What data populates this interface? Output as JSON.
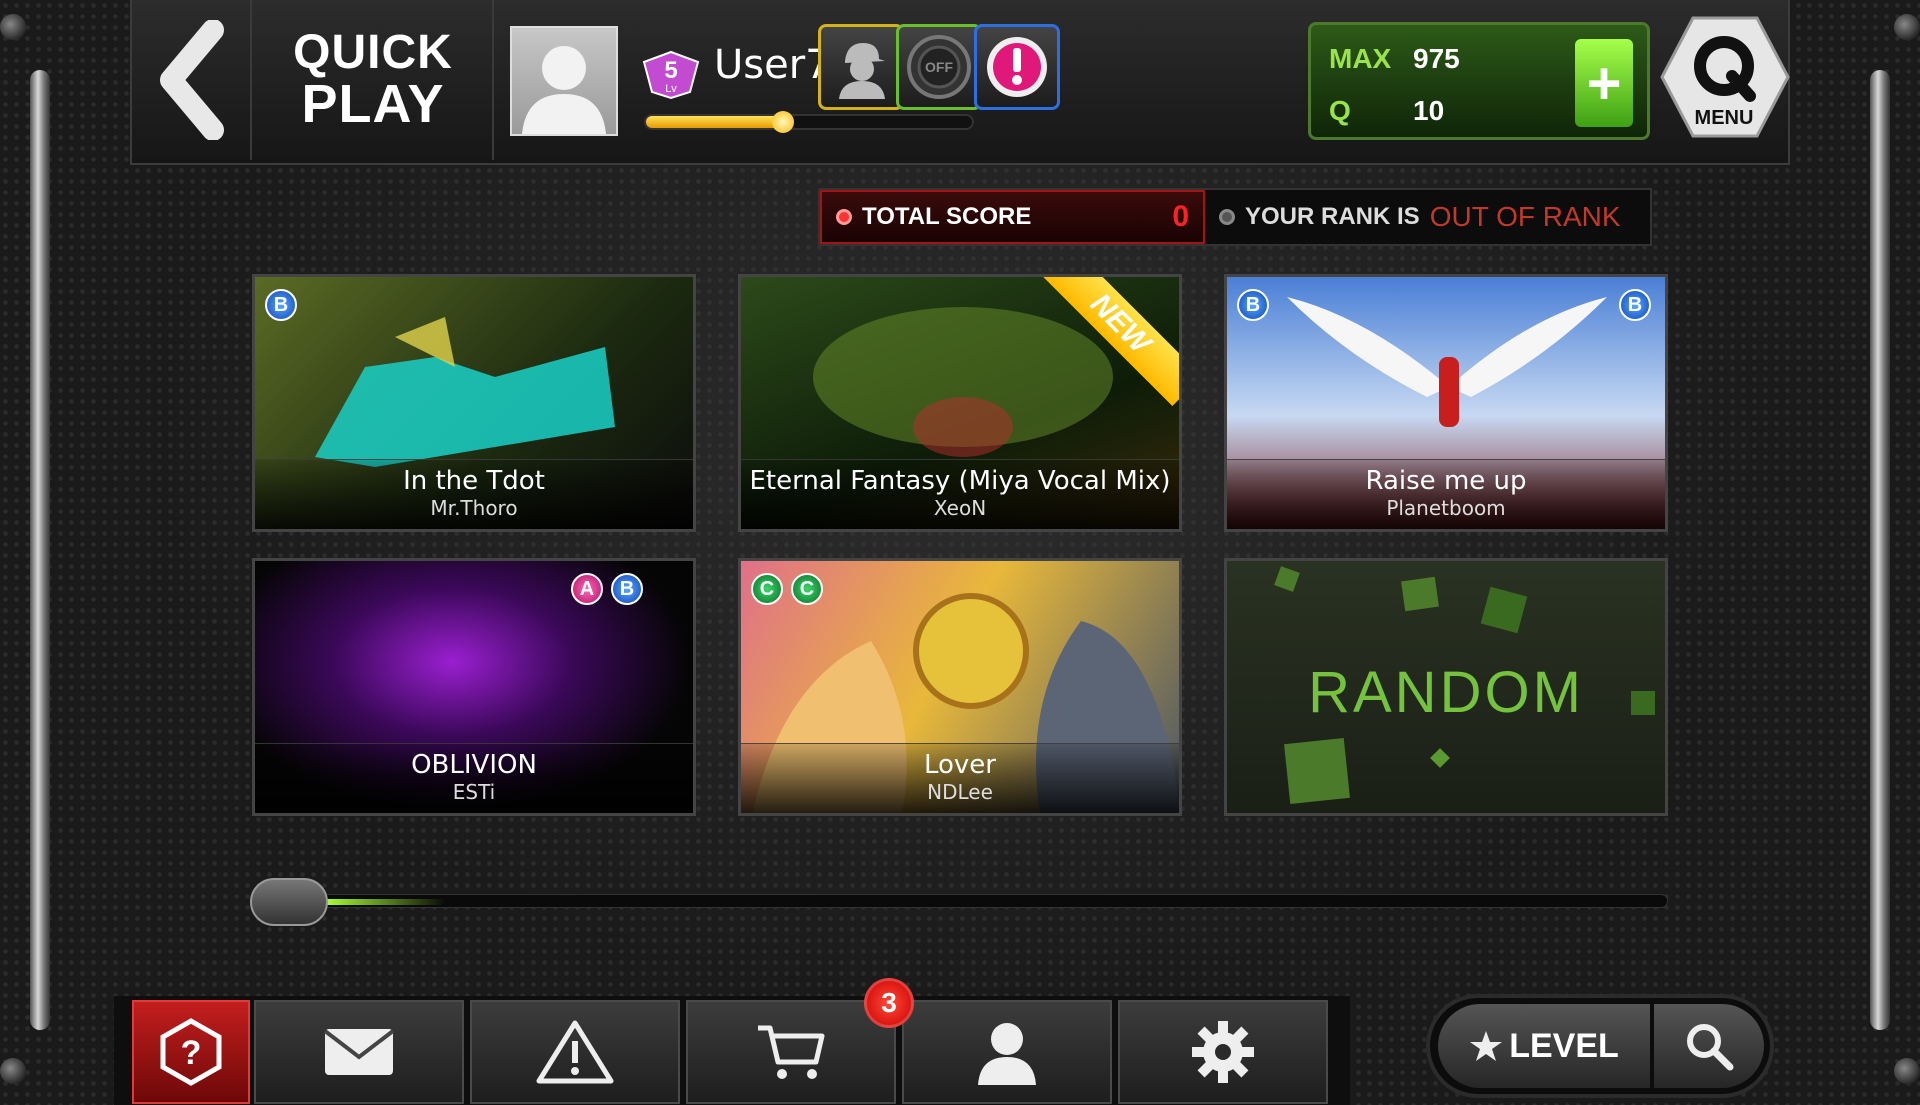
{
  "header": {
    "title_line1": "QUICK",
    "title_line2": "PLAY",
    "username": "User76988354",
    "level": "5",
    "level_label": "Lv",
    "xp_fraction": 0.42,
    "toggle_off_label": "OFF",
    "max_label": "MAX",
    "max_value": "975",
    "q_label": "Q",
    "q_value": "10",
    "plus_label": "+",
    "menu_label": "MENU"
  },
  "score_strip": {
    "total_score_label": "TOTAL SCORE",
    "total_score_value": "0",
    "rank_label": "YOUR RANK IS",
    "rank_value": "OUT OF RANK"
  },
  "songs": [
    {
      "title": "In the Tdot",
      "artist": "Mr.Thoro",
      "badges": [
        "B"
      ],
      "is_new": false
    },
    {
      "title": "Eternal Fantasy (Miya Vocal Mix)",
      "artist": "XeoN",
      "badges": [],
      "is_new": true,
      "new_label": "NEW"
    },
    {
      "title": "Raise me up",
      "artist": "Planetboom",
      "badges": [
        "B",
        "B"
      ],
      "is_new": false
    },
    {
      "title": "OBLIVION",
      "artist": "ESTi",
      "badges": [
        "A",
        "B"
      ],
      "is_new": false
    },
    {
      "title": "Lover",
      "artist": "NDLee",
      "badges": [
        "C",
        "C"
      ],
      "is_new": false
    }
  ],
  "random_tile": {
    "label": "RANDOM"
  },
  "page_slider": {
    "position": 0.0
  },
  "bottom_bar": {
    "items": [
      {
        "icon": "help-hexagon-icon"
      },
      {
        "icon": "mail-icon"
      },
      {
        "icon": "warning-icon"
      },
      {
        "icon": "cart-icon"
      },
      {
        "icon": "profile-icon"
      },
      {
        "icon": "gear-icon"
      }
    ],
    "cart_badge_count": "3",
    "level_sort_label": "LEVEL"
  },
  "colors": {
    "accent_green": "#74c23e",
    "score_red": "#ff2222",
    "rank_red": "#c0392b",
    "xp_yellow": "#ffcc00"
  }
}
